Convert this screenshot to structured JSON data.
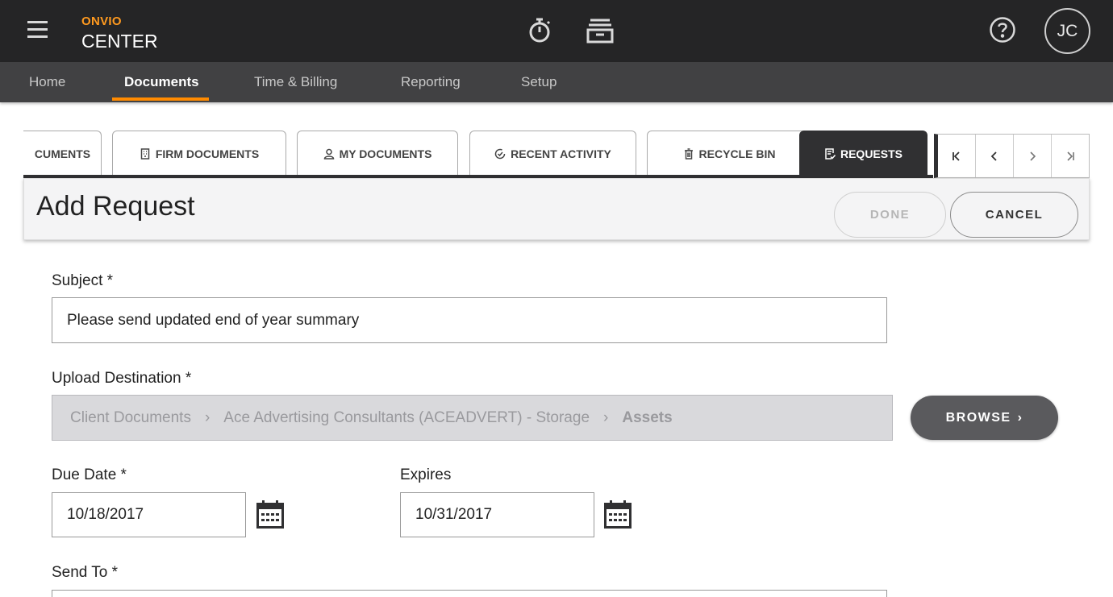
{
  "header": {
    "brand_top": "ONVIO",
    "brand_main": "CENTER",
    "user_initials": "JC"
  },
  "nav": {
    "items": [
      {
        "label": "Home"
      },
      {
        "label": "Documents"
      },
      {
        "label": "Time & Billing"
      },
      {
        "label": "Reporting"
      },
      {
        "label": "Setup"
      }
    ],
    "active": "Documents"
  },
  "tabs": {
    "items": [
      {
        "label": "CUMENTS"
      },
      {
        "label": "FIRM DOCUMENTS"
      },
      {
        "label": "MY DOCUMENTS"
      },
      {
        "label": "RECENT ACTIVITY"
      },
      {
        "label": "RECYCLE BIN"
      },
      {
        "label": "REQUESTS"
      }
    ],
    "active": "REQUESTS"
  },
  "panel": {
    "title": "Add Request",
    "done_label": "DONE",
    "cancel_label": "CANCEL"
  },
  "form": {
    "subject_label": "Subject *",
    "subject_value": "Please send updated end of year summary",
    "destination_label": "Upload Destination *",
    "destination_path": [
      "Client Documents",
      "Ace Advertising Consultants (ACEADVERT) - Storage",
      "Assets"
    ],
    "browse_label": "BROWSE",
    "due_date_label": "Due Date *",
    "due_date_value": "10/18/2017",
    "expires_label": "Expires",
    "expires_value": "10/31/2017",
    "send_to_label": "Send To *"
  },
  "colors": {
    "header_bg": "#252526",
    "nav_bg": "#414143",
    "accent": "#ff8a00",
    "brand_orange": "#ff9a1f",
    "active_tab": "#303032"
  }
}
